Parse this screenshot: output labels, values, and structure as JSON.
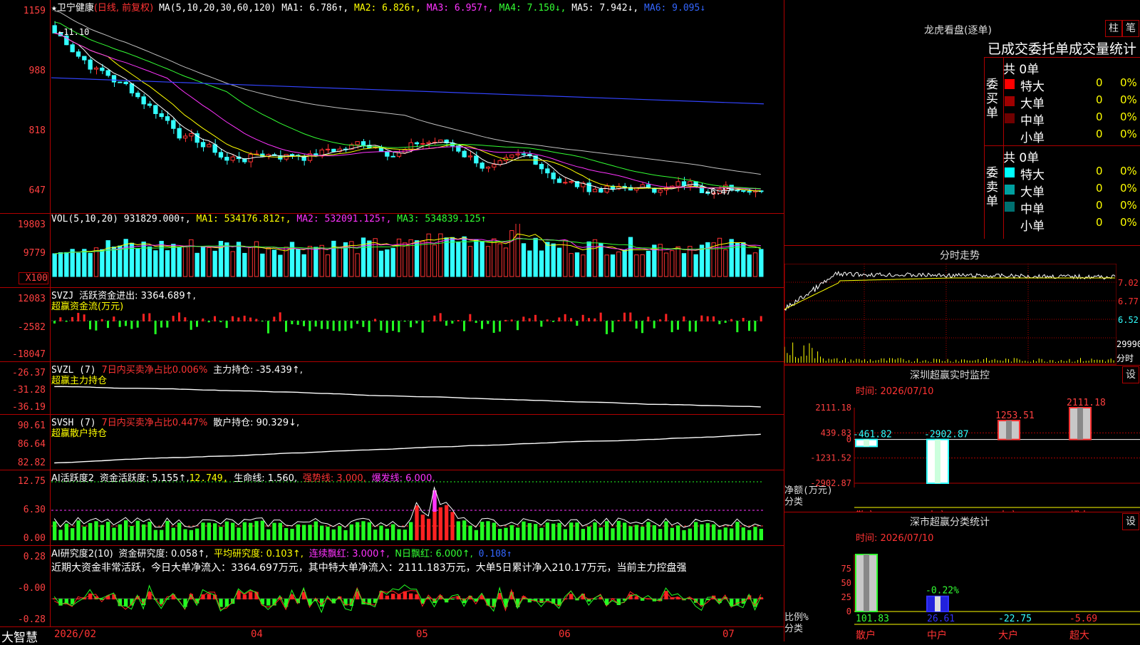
{
  "stock": {
    "name": "卫宁健康",
    "mode": "(日线, 前复权)",
    "star": "★"
  },
  "main_pane": {
    "y_ticks": [
      "1159",
      "988",
      "818",
      "647"
    ],
    "ma_params": "MA(5,10,20,30,60,120)",
    "ma1": "MA1: 6.786↑,",
    "ma2": "MA2: 6.826↑,",
    "ma3": "MA3: 6.957↑,",
    "ma4": "MA4: 7.150↓,",
    "ma5": "MA5: 7.942↓,",
    "ma6": "MA6: 9.095↓",
    "high_mark": "←11.10",
    "low_mark": "←6.47"
  },
  "vol_pane": {
    "y_ticks": [
      "19803",
      "9779"
    ],
    "unit": "X100",
    "params": "VOL(5,10,20)",
    "vol": "931829.000↑,",
    "ma1": "MA1: 534176.812↑,",
    "ma2": "MA2: 532091.125↑,",
    "ma3": "MA3: 534839.125↑"
  },
  "svzj_pane": {
    "y_ticks": [
      "12083",
      "-2582",
      "-18047"
    ],
    "label": "SVZJ",
    "value": "活跃资金进出: 3364.689↑,",
    "subtitle": "超赢资金流(万元)"
  },
  "svzl_pane": {
    "y_ticks": [
      "-26.37",
      "-31.28",
      "-36.19"
    ],
    "label": "SVZL (7)",
    "ratio": "7日内买卖净占比0.006%",
    "value": "主力持仓: -35.439↑,",
    "subtitle": "超赢主力持仓"
  },
  "svsh_pane": {
    "y_ticks": [
      "90.61",
      "86.64",
      "82.82"
    ],
    "label": "SVSH (7)",
    "ratio": "7日内买卖净占比0.447%",
    "value": "散户持仓: 90.329↓,",
    "subtitle": "超赢散户持仓"
  },
  "ai_active_pane": {
    "y_ticks": [
      "12.75",
      "6.30",
      "0.00"
    ],
    "label": "AI活跃度2",
    "v1": "资金活跃度: 5.155↑,",
    "v2": "12.749,",
    "v3": "生命线: 1.560,",
    "v4": "强势线: 3.000,",
    "v5": "爆发线: 6.000,"
  },
  "ai_research_pane": {
    "y_ticks": [
      "0.28",
      "-0.00",
      "-0.28"
    ],
    "label": "AI研究度2(10)",
    "v1": "资金研究度: 0.058↑,",
    "v2": "平均研究度: 0.103↑,",
    "v3": "连续飘红: 3.000↑,",
    "v4": "N日飘红: 6.000↑,",
    "v5": "0.108↑",
    "summary": "近期大资金非常活跃，今日大单净流入：3364.697万元，其中特大单净流入：2111.183万元，大单5日累计净入210.17万元，当前主力控盘强"
  },
  "x_axis": {
    "labels": [
      "2026/02",
      "04",
      "05",
      "06",
      "07"
    ],
    "brand": "大智慧"
  },
  "lhb": {
    "title": "龙虎看盘(逐单)",
    "btn1": "柱",
    "btn2": "笔",
    "subtitle": "已成交委托单成交量统计",
    "buy_group": "委买单",
    "sell_group": "委卖单",
    "buy_total": "共 0单",
    "sell_total": "共 0单",
    "buy_rows": [
      {
        "label": "特大",
        "count": "0",
        "pct": "0%",
        "color": "#ff0000"
      },
      {
        "label": "大单",
        "count": "0",
        "pct": "0%",
        "color": "#a00000"
      },
      {
        "label": "中单",
        "count": "0",
        "pct": "0%",
        "color": "#700000"
      },
      {
        "label": "小单",
        "count": "0",
        "pct": "0%",
        "color": ""
      }
    ],
    "sell_rows": [
      {
        "label": "特大",
        "count": "0",
        "pct": "0%",
        "color": "#00ffff"
      },
      {
        "label": "大单",
        "count": "0",
        "pct": "0%",
        "color": "#00a0a0"
      },
      {
        "label": "中单",
        "count": "0",
        "pct": "0%",
        "color": "#007070"
      },
      {
        "label": "小单",
        "count": "0",
        "pct": "0%",
        "color": ""
      }
    ]
  },
  "intraday": {
    "title": "分时走势",
    "price_ticks": [
      "7.02",
      "6.77",
      "6.52"
    ],
    "vol_tick": "29990",
    "vol_unit": "分时"
  },
  "sz_monitor": {
    "title": "深圳超赢实时监控",
    "btn": "设",
    "time": "时间: 2026/07/10",
    "y_ticks": [
      "2111.18",
      "439.83",
      "0",
      "-1231.52",
      "-2902.87"
    ],
    "y_unit": "净额(万元)",
    "x_unit": "分类",
    "categories": [
      "散户",
      "中户",
      "大户",
      "超大"
    ],
    "values": [
      -461.82,
      -2902.87,
      1253.51,
      2111.18
    ],
    "value_labels": [
      "-461.82",
      "-2902.87",
      "1253.51",
      "2111.18"
    ]
  },
  "sz_class": {
    "title": "深市超赢分类统计",
    "btn": "设",
    "time": "时间: 2026/07/10",
    "y_ticks": [
      "75",
      "50",
      "25",
      "0"
    ],
    "y_unit": "比例%",
    "x_unit": "分类",
    "categories": [
      "散户",
      "中户",
      "大户",
      "超大"
    ],
    "values": [
      101.83,
      26.61,
      -22.75,
      -5.69
    ],
    "value_labels": [
      "101.83",
      "26.61",
      "-22.75",
      "-5.69"
    ],
    "extra_label": "-0.22%"
  },
  "colors": {
    "up": "#ff3333",
    "down": "#33ffff",
    "grid": "#b00000"
  }
}
